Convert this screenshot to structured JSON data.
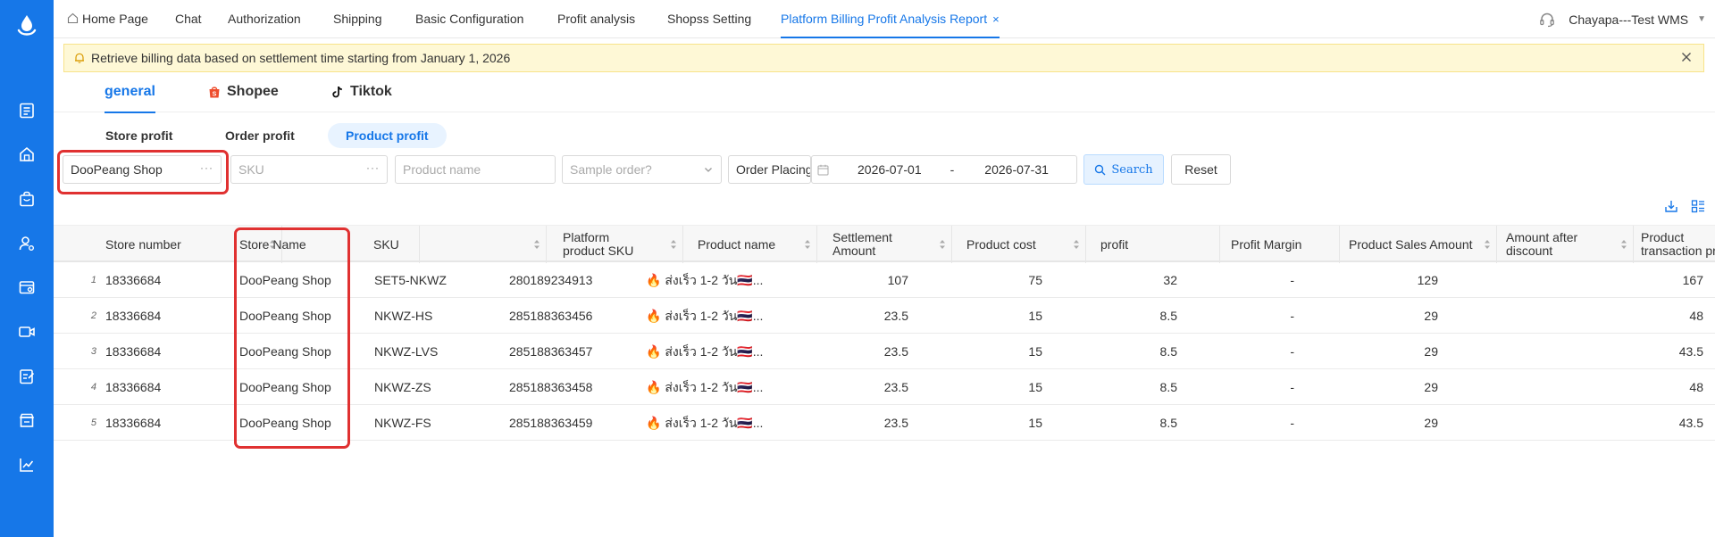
{
  "topnav": {
    "tabs": [
      {
        "label": "Home Page"
      },
      {
        "label": "Chat"
      },
      {
        "label": "Authorization"
      },
      {
        "label": "Shipping"
      },
      {
        "label": "Basic Configuration"
      },
      {
        "label": "Profit analysis"
      },
      {
        "label": "Shopss Setting"
      },
      {
        "label": "Platform Billing Profit Analysis Report"
      }
    ],
    "active_close": "×",
    "user": "Chayapa---Test WMS"
  },
  "notice": {
    "text": "Retrieve billing data based on settlement time starting from January 1, 2026"
  },
  "platform_tabs": [
    {
      "label": "general"
    },
    {
      "label": "Shopee"
    },
    {
      "label": "Tiktok"
    }
  ],
  "sub_tabs": [
    {
      "label": "Store profit"
    },
    {
      "label": "Order profit"
    },
    {
      "label": "Product profit"
    }
  ],
  "filters": {
    "store_value": "DooPeang Shop",
    "sku_placeholder": "SKU",
    "product_name_placeholder": "Product name",
    "sample_order_placeholder": "Sample order?",
    "time_type_value": "Order Placing",
    "date_start": "2026-07-01",
    "date_sep": "-",
    "date_end": "2026-07-31",
    "search_label": "Search",
    "reset_label": "Reset"
  },
  "table": {
    "headers": [
      "Store number",
      "Store Name",
      "SKU",
      "Platform product SKU",
      "Product name",
      "Settlement Amount",
      "Product cost",
      "profit",
      "Profit Margin",
      "Product Sales Amount",
      "Amount after discount",
      "Product transaction price"
    ],
    "rows": [
      {
        "idx": "1",
        "store_number": "18336684",
        "store_name": "DooPeang Shop",
        "sku": "SET5-NKWZ",
        "platform_sku": "280189234913",
        "product_name": "🔥 ส่งเร็ว 1-2 วัน🇹🇭...",
        "settlement": "107",
        "cost": "75",
        "profit": "32",
        "margin": "-",
        "sales": "129",
        "after_discount": "",
        "price": "167"
      },
      {
        "idx": "2",
        "store_number": "18336684",
        "store_name": "DooPeang Shop",
        "sku": "NKWZ-HS",
        "platform_sku": "285188363456",
        "product_name": "🔥 ส่งเร็ว 1-2 วัน🇹🇭...",
        "settlement": "23.5",
        "cost": "15",
        "profit": "8.5",
        "margin": "-",
        "sales": "29",
        "after_discount": "",
        "price": "48"
      },
      {
        "idx": "3",
        "store_number": "18336684",
        "store_name": "DooPeang Shop",
        "sku": "NKWZ-LVS",
        "platform_sku": "285188363457",
        "product_name": "🔥 ส่งเร็ว 1-2 วัน🇹🇭...",
        "settlement": "23.5",
        "cost": "15",
        "profit": "8.5",
        "margin": "-",
        "sales": "29",
        "after_discount": "",
        "price": "43.5"
      },
      {
        "idx": "4",
        "store_number": "18336684",
        "store_name": "DooPeang Shop",
        "sku": "NKWZ-ZS",
        "platform_sku": "285188363458",
        "product_name": "🔥 ส่งเร็ว 1-2 วัน🇹🇭...",
        "settlement": "23.5",
        "cost": "15",
        "profit": "8.5",
        "margin": "-",
        "sales": "29",
        "after_discount": "",
        "price": "48"
      },
      {
        "idx": "5",
        "store_number": "18336684",
        "store_name": "DooPeang Shop",
        "sku": "NKWZ-FS",
        "platform_sku": "285188363459",
        "product_name": "🔥 ส่งเร็ว 1-2 วัน🇹🇭...",
        "settlement": "23.5",
        "cost": "15",
        "profit": "8.5",
        "margin": "-",
        "sales": "29",
        "after_discount": "",
        "price": "43.5"
      }
    ]
  },
  "colors": {
    "accent": "#1677e8",
    "sidebar": "#1677e8",
    "notice_bg": "#fef8d6",
    "highlight": "#e03131",
    "shopee": "#ee4d2d"
  },
  "icons": [
    "logo-icon",
    "document-icon",
    "home-store-icon",
    "bag-icon",
    "user-settings-icon",
    "store-settings-icon",
    "video-icon",
    "edit-list-icon",
    "shop-icon",
    "chart-icon",
    "headset-icon",
    "bell-icon",
    "close-icon",
    "shopee-icon",
    "tiktok-icon",
    "calendar-icon",
    "search-icon",
    "export-icon",
    "column-settings-icon"
  ]
}
